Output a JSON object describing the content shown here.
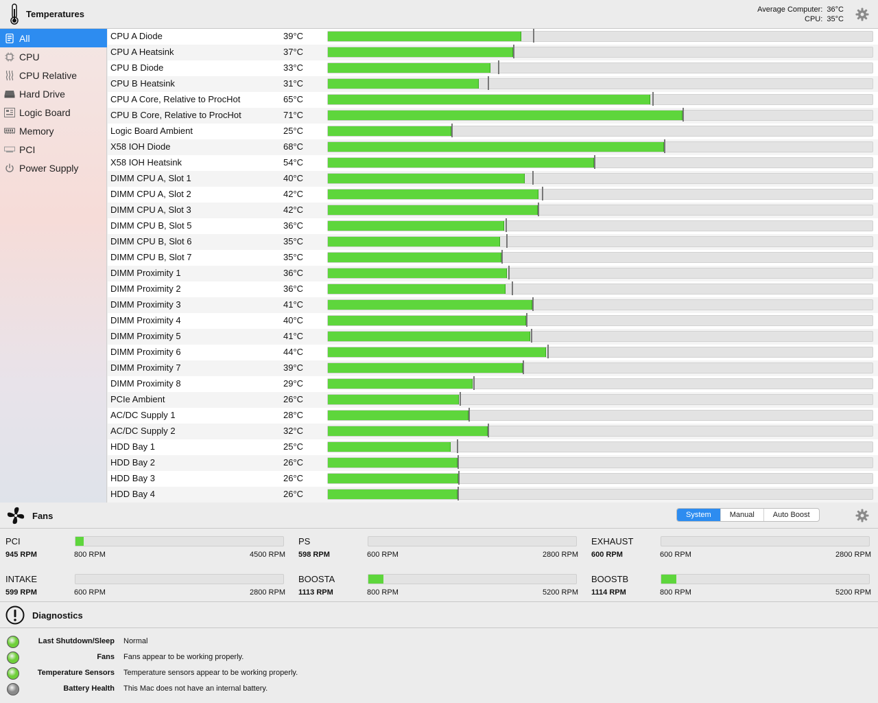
{
  "temperatures": {
    "title": "Temperatures",
    "average_label": "Average Computer:",
    "average_value": "36°C",
    "cpu_label": "CPU:",
    "cpu_value": "35°C"
  },
  "sidebar": {
    "items": [
      {
        "label": "All",
        "icon": "list-icon",
        "selected": true
      },
      {
        "label": "CPU",
        "icon": "cpu-chip-icon"
      },
      {
        "label": "CPU Relative",
        "icon": "heat-waves-icon"
      },
      {
        "label": "Hard Drive",
        "icon": "hard-drive-icon"
      },
      {
        "label": "Logic Board",
        "icon": "logic-board-icon"
      },
      {
        "label": "Memory",
        "icon": "memory-icon"
      },
      {
        "label": "PCI",
        "icon": "pci-card-icon"
      },
      {
        "label": "Power Supply",
        "icon": "power-icon"
      }
    ]
  },
  "sensors": [
    {
      "name": "CPU A Diode",
      "temp": "39°C",
      "fill": 0.354,
      "marker": 0.376
    },
    {
      "name": "CPU A Heatsink",
      "temp": "37°C",
      "fill": 0.339,
      "marker": 0.339
    },
    {
      "name": "CPU B Diode",
      "temp": "33°C",
      "fill": 0.298,
      "marker": 0.311
    },
    {
      "name": "CPU B Heatsink",
      "temp": "31°C",
      "fill": 0.277,
      "marker": 0.293
    },
    {
      "name": "CPU A Core, Relative to ProcHot",
      "temp": "65°C",
      "fill": 0.59,
      "marker": 0.594
    },
    {
      "name": "CPU B Core, Relative to ProcHot",
      "temp": "71°C",
      "fill": 0.649,
      "marker": 0.649
    },
    {
      "name": "Logic Board Ambient",
      "temp": "25°C",
      "fill": 0.226,
      "marker": 0.226
    },
    {
      "name": "X58 IOH Diode",
      "temp": "68°C",
      "fill": 0.616,
      "marker": 0.616
    },
    {
      "name": "X58 IOH Heatsink",
      "temp": "54°C",
      "fill": 0.488,
      "marker": 0.488
    },
    {
      "name": "DIMM CPU A, Slot 1",
      "temp": "40°C",
      "fill": 0.36,
      "marker": 0.374
    },
    {
      "name": "DIMM CPU A, Slot 2",
      "temp": "42°C",
      "fill": 0.386,
      "marker": 0.392
    },
    {
      "name": "DIMM CPU A, Slot 3",
      "temp": "42°C",
      "fill": 0.384,
      "marker": 0.384
    },
    {
      "name": "DIMM CPU B, Slot 5",
      "temp": "36°C",
      "fill": 0.323,
      "marker": 0.326
    },
    {
      "name": "DIMM CPU B, Slot 6",
      "temp": "35°C",
      "fill": 0.315,
      "marker": 0.327
    },
    {
      "name": "DIMM CPU B, Slot 7",
      "temp": "35°C",
      "fill": 0.318,
      "marker": 0.318
    },
    {
      "name": "DIMM Proximity 1",
      "temp": "36°C",
      "fill": 0.328,
      "marker": 0.33
    },
    {
      "name": "DIMM Proximity 2",
      "temp": "36°C",
      "fill": 0.325,
      "marker": 0.337
    },
    {
      "name": "DIMM Proximity 3",
      "temp": "41°C",
      "fill": 0.374,
      "marker": 0.374
    },
    {
      "name": "DIMM Proximity 4",
      "temp": "40°C",
      "fill": 0.363,
      "marker": 0.363
    },
    {
      "name": "DIMM Proximity 5",
      "temp": "41°C",
      "fill": 0.37,
      "marker": 0.372
    },
    {
      "name": "DIMM Proximity 6",
      "temp": "44°C",
      "fill": 0.4,
      "marker": 0.402
    },
    {
      "name": "DIMM Proximity 7",
      "temp": "39°C",
      "fill": 0.357,
      "marker": 0.357
    },
    {
      "name": "DIMM Proximity 8",
      "temp": "29°C",
      "fill": 0.265,
      "marker": 0.266
    },
    {
      "name": "PCIe Ambient",
      "temp": "26°C",
      "fill": 0.24,
      "marker": 0.241
    },
    {
      "name": "AC/DC Supply 1",
      "temp": "28°C",
      "fill": 0.258,
      "marker": 0.258
    },
    {
      "name": "AC/DC Supply 2",
      "temp": "32°C",
      "fill": 0.293,
      "marker": 0.293
    },
    {
      "name": "HDD Bay 1",
      "temp": "25°C",
      "fill": 0.225,
      "marker": 0.236
    },
    {
      "name": "HDD Bay 2",
      "temp": "26°C",
      "fill": 0.238,
      "marker": 0.238
    },
    {
      "name": "HDD Bay 3",
      "temp": "26°C",
      "fill": 0.239,
      "marker": 0.239
    },
    {
      "name": "HDD Bay 4",
      "temp": "26°C",
      "fill": 0.238,
      "marker": 0.238
    }
  ],
  "fans": {
    "title": "Fans",
    "modes": [
      "System",
      "Manual",
      "Auto Boost"
    ],
    "active_mode": "System",
    "list": [
      {
        "name": "PCI",
        "rpm": "945 RPM",
        "min": "800 RPM",
        "max": "4500 RPM",
        "fill": 0.039
      },
      {
        "name": "PS",
        "rpm": "598 RPM",
        "min": "600 RPM",
        "max": "2800 RPM",
        "fill": 0
      },
      {
        "name": "EXHAUST",
        "rpm": "600 RPM",
        "min": "600 RPM",
        "max": "2800 RPM",
        "fill": 0
      },
      {
        "name": "INTAKE",
        "rpm": "599 RPM",
        "min": "600 RPM",
        "max": "2800 RPM",
        "fill": 0
      },
      {
        "name": "BOOSTA",
        "rpm": "1113 RPM",
        "min": "800 RPM",
        "max": "5200 RPM",
        "fill": 0.071
      },
      {
        "name": "BOOSTB",
        "rpm": "1114 RPM",
        "min": "800 RPM",
        "max": "5200 RPM",
        "fill": 0.071
      }
    ]
  },
  "diagnostics": {
    "title": "Diagnostics",
    "items": [
      {
        "label": "Last Shutdown/Sleep",
        "value": "Normal",
        "status": "green"
      },
      {
        "label": "Fans",
        "value": "Fans appear to be working properly.",
        "status": "green"
      },
      {
        "label": "Temperature Sensors",
        "value": "Temperature sensors appear to be working properly.",
        "status": "green"
      },
      {
        "label": "Battery Health",
        "value": "This Mac does not have an internal battery.",
        "status": "gray"
      }
    ]
  },
  "colors": {
    "accent": "#2d8cf0",
    "bar_fill": "#5ed63c",
    "status_green": "#6fcf3a",
    "status_gray": "#8a8a8a"
  }
}
